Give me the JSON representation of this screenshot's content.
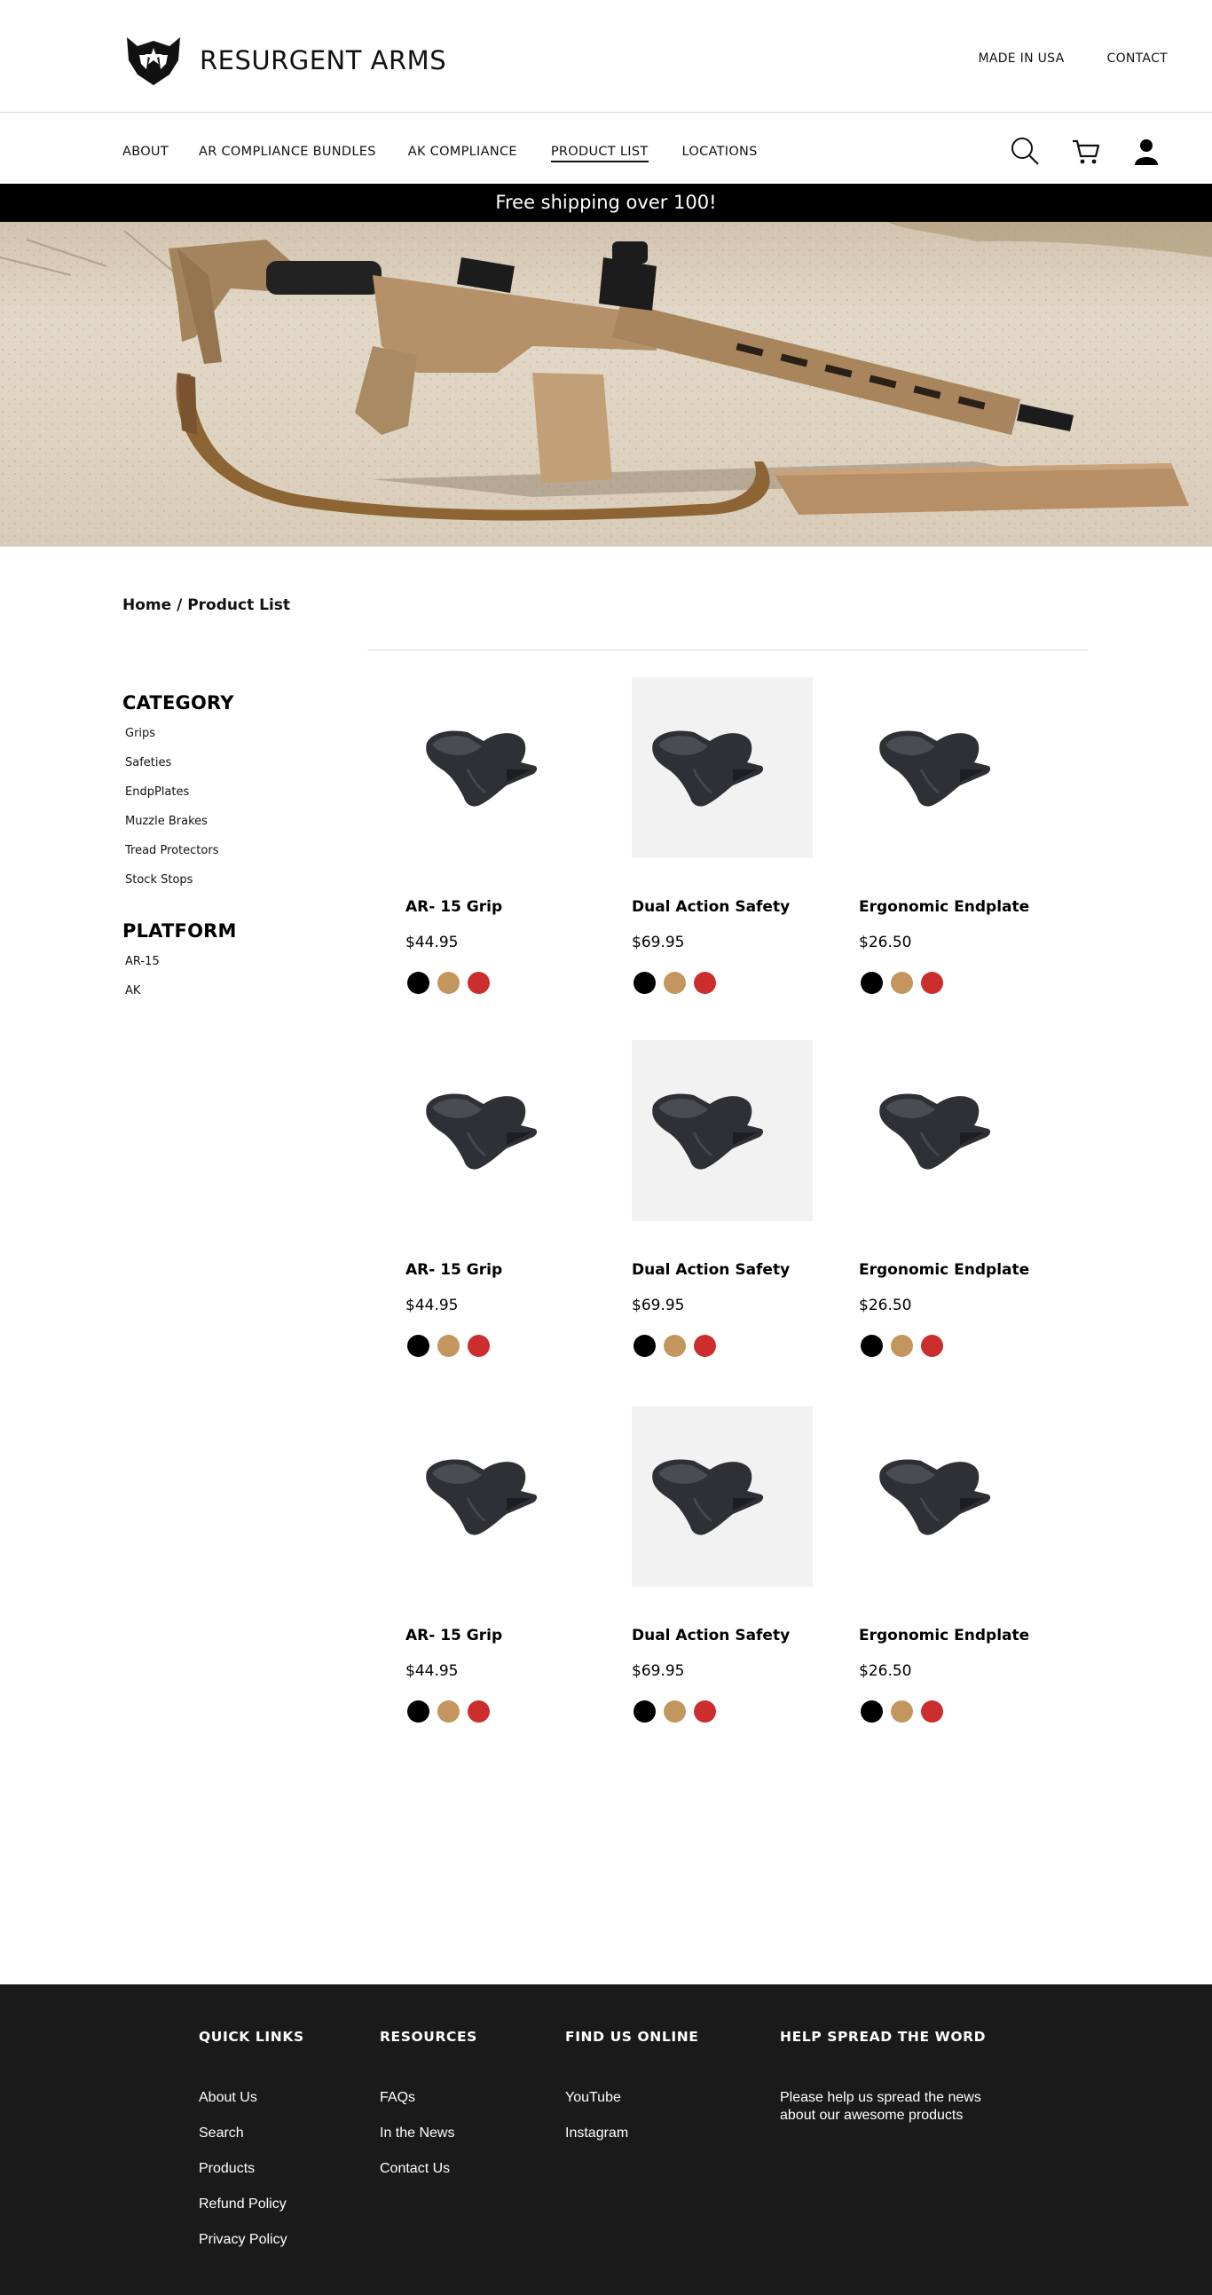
{
  "header": {
    "brand": "RESURGENT ARMS",
    "top_links": [
      "MADE IN USA",
      "CONTACT"
    ]
  },
  "nav": {
    "items": [
      {
        "label": "ABOUT",
        "active": false
      },
      {
        "label": "AR COMPLIANCE BUNDLES",
        "active": false
      },
      {
        "label": "AK COMPLIANCE",
        "active": false
      },
      {
        "label": "PRODUCT LIST",
        "active": true
      },
      {
        "label": "LOCATIONS",
        "active": false
      }
    ],
    "icons": [
      "search-icon",
      "cart-icon",
      "account-icon"
    ]
  },
  "promo": {
    "text": "Free shipping over 100!"
  },
  "breadcrumb": {
    "home": "Home",
    "separator": " / ",
    "current": "Product List"
  },
  "sidebar": {
    "category": {
      "heading": "CATEGORY",
      "items": [
        "Grips",
        "Safeties",
        "EndpPlates",
        "Muzzle Brakes",
        "Tread Protectors",
        "Stock Stops"
      ]
    },
    "platform": {
      "heading": "PLATFORM",
      "items": [
        "AR-15",
        "AK"
      ]
    }
  },
  "swatch_colors": [
    "#000000",
    "#c4965f",
    "#cc2d2d"
  ],
  "products": [
    {
      "name": "AR- 15 Grip",
      "price": "$44.95",
      "shaded": false
    },
    {
      "name": "Dual Action Safety",
      "price": "$69.95",
      "shaded": true
    },
    {
      "name": "Ergonomic Endplate",
      "price": "$26.50",
      "shaded": false
    },
    {
      "name": "AR- 15 Grip",
      "price": "$44.95",
      "shaded": false
    },
    {
      "name": "Dual Action Safety",
      "price": "$69.95",
      "shaded": true
    },
    {
      "name": "Ergonomic Endplate",
      "price": "$26.50",
      "shaded": false
    },
    {
      "name": "AR- 15 Grip",
      "price": "$44.95",
      "shaded": false
    },
    {
      "name": "Dual Action Safety",
      "price": "$69.95",
      "shaded": true
    },
    {
      "name": "Ergonomic Endplate",
      "price": "$26.50",
      "shaded": false
    }
  ],
  "footer": {
    "quick_links": {
      "title": "QUICK LINKS",
      "items": [
        "About Us",
        "Search",
        "Products",
        "Refund Policy",
        "Privacy Policy"
      ]
    },
    "resources": {
      "title": "RESOURCES",
      "items": [
        "FAQs",
        "In the News",
        "Contact Us"
      ]
    },
    "find_us": {
      "title": "FIND US ONLINE",
      "items": [
        "YouTube",
        "Instagram"
      ]
    },
    "spread": {
      "title": "HELP SPREAD THE WORD",
      "text": "Please help us spread the news about our awesome products"
    }
  }
}
